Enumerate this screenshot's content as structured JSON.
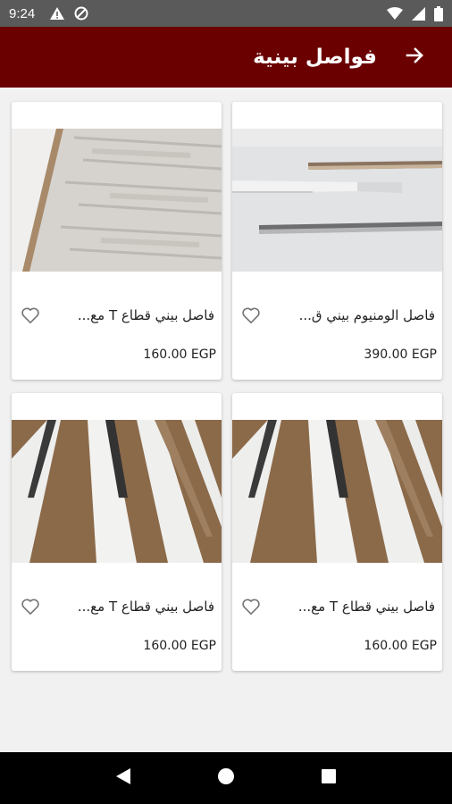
{
  "status_bar": {
    "time": "9:24",
    "icons": [
      "alert-icon",
      "no-disturb-icon",
      "wifi-icon",
      "signal-icon",
      "battery-icon"
    ]
  },
  "app_bar": {
    "title": "فواصل بينية",
    "back_icon": "arrow-back-icon",
    "background": "#6b0000"
  },
  "products": [
    {
      "name": "فاصل الومنيوم بيني ق...",
      "price": "390.00 EGP",
      "image": "aluminium-profile-photo",
      "favorite_icon": "heart-outline-icon"
    },
    {
      "name": "فاصل بيني قطاع T مع...",
      "price": "160.00 EGP",
      "image": "wood-floor-profile-photo",
      "favorite_icon": "heart-outline-icon"
    },
    {
      "name": "فاصل بيني قطاع T مع...",
      "price": "160.00 EGP",
      "image": "white-t-profile-photo",
      "favorite_icon": "heart-outline-icon"
    },
    {
      "name": "فاصل بيني قطاع T مع...",
      "price": "160.00 EGP",
      "image": "white-t-profile-photo",
      "favorite_icon": "heart-outline-icon"
    }
  ],
  "nav_bar": {
    "buttons": [
      "back-triangle-icon",
      "home-circle-icon",
      "recents-square-icon"
    ]
  }
}
